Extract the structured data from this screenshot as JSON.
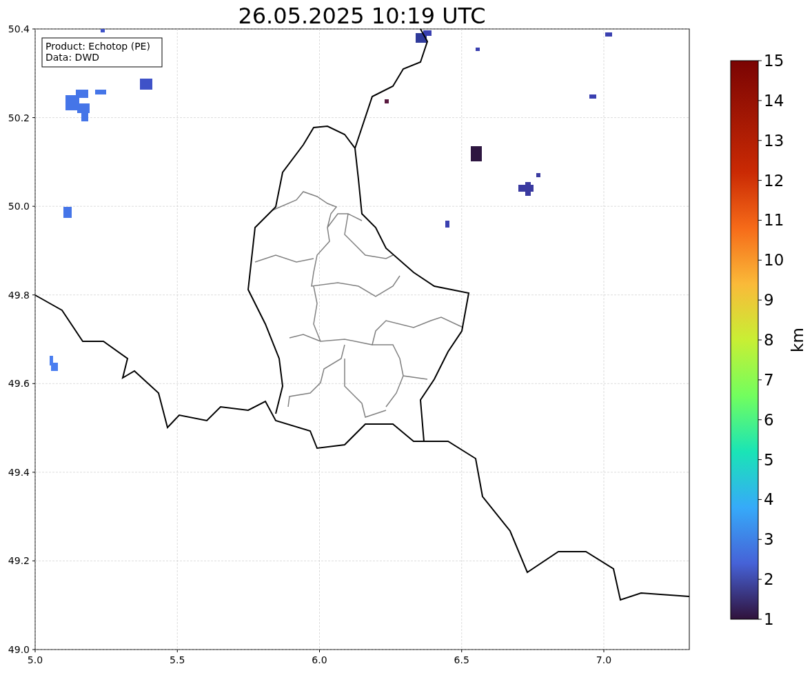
{
  "title": "26.05.2025 10:19 UTC",
  "info_box": [
    "Product: Echotop (PE)",
    "Data: DWD"
  ],
  "x_ticks": [
    "5.0",
    "5.5",
    "6.0",
    "6.5",
    "7.0"
  ],
  "y_ticks": [
    "50.4",
    "50.2",
    "50.0",
    "49.8",
    "49.6",
    "49.4",
    "49.2",
    "49.0"
  ],
  "colorbar": {
    "label": "km",
    "ticks": [
      "15",
      "14",
      "13",
      "12",
      "11",
      "10",
      "9",
      "8",
      "7",
      "6",
      "5",
      "4",
      "3",
      "2",
      "1"
    ]
  }
}
